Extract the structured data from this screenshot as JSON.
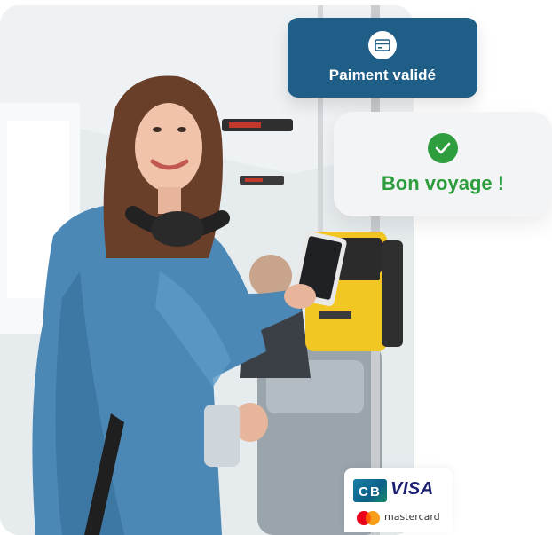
{
  "payment_card": {
    "label": "Paiment validé",
    "icon": "credit-card-icon",
    "background": "#1f5e86"
  },
  "voyage_card": {
    "label": "Bon voyage !",
    "icon": "check-circle-icon",
    "accent": "#2e9d3e"
  },
  "payment_methods": {
    "visa": "VISA",
    "mastercard": "mastercard",
    "cb_icon": "cb-card-icon",
    "mastercard_icon": "mastercard-icon"
  },
  "photo": {
    "description_icon": "person-tapping-phone-on-transit-validator"
  }
}
